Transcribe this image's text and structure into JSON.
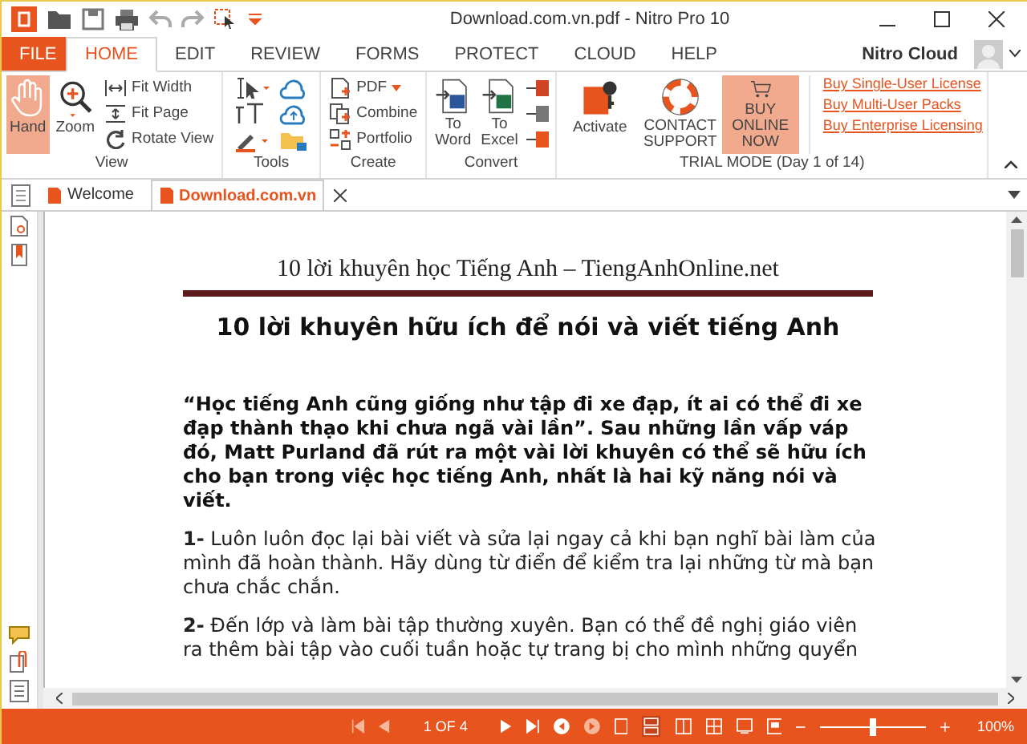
{
  "window": {
    "title": "Download.com.vn.pdf - Nitro Pro 10"
  },
  "menu_tabs": [
    {
      "label": "FILE",
      "kind": "file",
      "selected": false
    },
    {
      "label": "HOME",
      "kind": "tab",
      "selected": true
    },
    {
      "label": "EDIT",
      "kind": "tab",
      "selected": false
    },
    {
      "label": "REVIEW",
      "kind": "tab",
      "selected": false
    },
    {
      "label": "FORMS",
      "kind": "tab",
      "selected": false
    },
    {
      "label": "PROTECT",
      "kind": "tab",
      "selected": false
    },
    {
      "label": "CLOUD",
      "kind": "tab",
      "selected": false
    },
    {
      "label": "HELP",
      "kind": "tab",
      "selected": false
    }
  ],
  "account": {
    "name": "Nitro Cloud"
  },
  "ribbon": {
    "view": {
      "label": "View",
      "large": [
        {
          "label": "Hand",
          "kind": "hand",
          "highlighted": true
        },
        {
          "label": "Zoom",
          "kind": "zoom",
          "highlighted": false
        }
      ],
      "small": [
        {
          "label": "Fit Width",
          "kind": "fitwidth"
        },
        {
          "label": "Fit Page",
          "kind": "fitpage"
        },
        {
          "label": "Rotate View",
          "kind": "rotate"
        }
      ]
    },
    "tools": {
      "label": "Tools"
    },
    "create": {
      "label": "Create",
      "small": [
        {
          "label": "PDF",
          "kind": "pdf"
        },
        {
          "label": "Combine",
          "kind": "combine"
        },
        {
          "label": "Portfolio",
          "kind": "portfolio"
        }
      ]
    },
    "convert": {
      "label": "Convert",
      "large": [
        {
          "label": "To Word",
          "kind": "word"
        },
        {
          "label": "To Excel",
          "kind": "excel"
        }
      ]
    },
    "trial": {
      "label": "TRIAL MODE (Day 1 of 14)",
      "large": [
        {
          "label": "Activate",
          "kind": "activate",
          "highlighted": false
        },
        {
          "label": "CONTACT SUPPORT",
          "kind": "support",
          "highlighted": false
        },
        {
          "label": "BUY ONLINE NOW",
          "kind": "cart",
          "highlighted": true
        }
      ],
      "links": [
        "Buy Single-User License",
        "Buy Multi-User Packs",
        "Buy Enterprise Licensing"
      ]
    }
  },
  "doc_tabs": [
    {
      "label": "Welcome",
      "selected": false
    },
    {
      "label": "Download.com.vn",
      "selected": true
    }
  ],
  "document": {
    "header": "10 lời khuyên học Tiếng Anh – TiengAnhOnline.net",
    "title": "10 lời khuyên hữu ích để nói và viết tiếng Anh",
    "intro": "“Học tiếng Anh cũng giống như tập đi xe đạp, ít ai có thể đi xe đạp thành thạo khi chưa ngã vài lần”. Sau những lần vấp váp đó, Matt Purland đã rút ra một vài lời khuyên có thể sẽ hữu ích cho bạn trong việc học tiếng Anh, nhất là hai kỹ năng nói và viết.",
    "items": [
      "**1-** Luôn luôn đọc lại bài viết và sửa lại ngay cả khi bạn nghĩ bài làm của mình đã hoàn thành. Hãy dùng từ điển để kiểm tra lại những từ mà bạn chưa chắc chắn.",
      "**2-** Đến lớp và làm bài tập thường xuyên. Bạn có thể đề nghị giáo viên ra thêm bài tập vào cuối tuần hoặc tự trang bị cho mình những quyển"
    ]
  },
  "status_bar": {
    "page": "1 OF 4",
    "zoom_slider": {
      "level": 0.5
    },
    "zoom": "100%"
  }
}
